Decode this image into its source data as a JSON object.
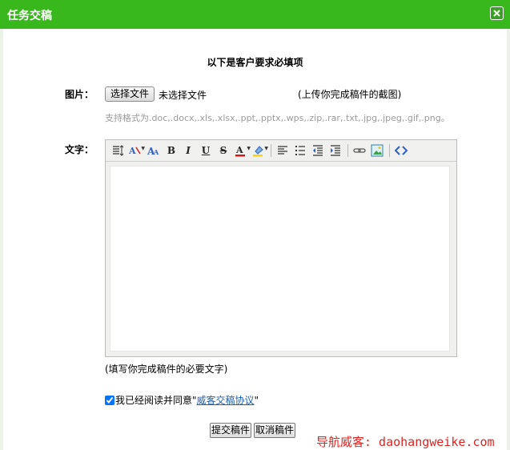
{
  "window": {
    "title": "任务交稿",
    "close_icon": "close-icon"
  },
  "form": {
    "heading": "以下是客户要求必填项",
    "image": {
      "label": "图片：",
      "choose_button": "选择文件",
      "file_status": "未选择文件",
      "hint": "(上传你完成稿件的截图)",
      "formats": "支持格式为.doc,.docx,.xls,.xlsx,.ppt,.pptx,.wps,.zip,.rar,.txt,.jpg,.jpeg,.gif,.png。"
    },
    "text": {
      "label": "文字：",
      "hint": "(填写你完成稿件的必要文字)",
      "toolbar": [
        "line-height-icon",
        "font-family-icon",
        "font-size-icon",
        "bold-icon",
        "italic-icon",
        "underline-icon",
        "strikethrough-icon",
        "font-color-icon",
        "highlight-color-icon",
        "align-left-icon",
        "unordered-list-icon",
        "outdent-icon",
        "indent-icon",
        "link-icon",
        "image-icon",
        "source-code-icon"
      ]
    },
    "agreement": {
      "checked": true,
      "prefix": "我已经阅读并同意\"",
      "link": "威客交稿协议",
      "suffix": "\""
    },
    "buttons": {
      "submit": "提交稿件",
      "cancel": "取消稿件"
    }
  },
  "watermark": "导航威客: daohangweike.com",
  "colors": {
    "titlebar": "#38b81c",
    "link": "#1f5fb0",
    "watermark": "#e0221f"
  }
}
